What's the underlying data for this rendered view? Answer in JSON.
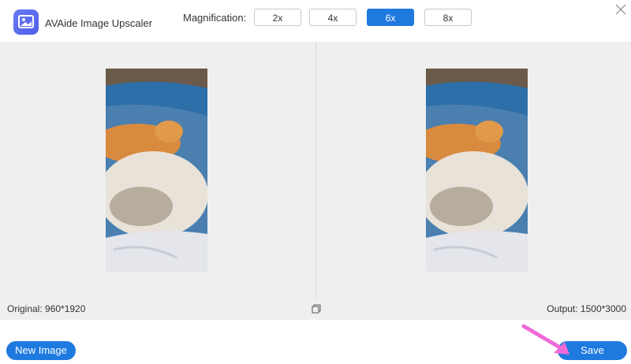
{
  "header": {
    "app_title": "AVAide Image Upscaler",
    "magnification_label": "Magnification:",
    "options": [
      "2x",
      "4x",
      "6x",
      "8x"
    ],
    "selected": "6x",
    "logo_icon": "image-upscale-icon",
    "close_icon": "close-icon"
  },
  "preview": {
    "original_label": "Original: 960*1920",
    "output_label": "Output: 1500*3000",
    "compare_icon": "copy-compare-icon",
    "photo_description_icon": "cat-and-dog-photo"
  },
  "actions": {
    "new_image_label": "New Image",
    "save_label": "Save"
  },
  "colors": {
    "accent": "#1f7ae0",
    "preview_bg": "#efefef",
    "annotation_arrow": "#f06ad8"
  }
}
